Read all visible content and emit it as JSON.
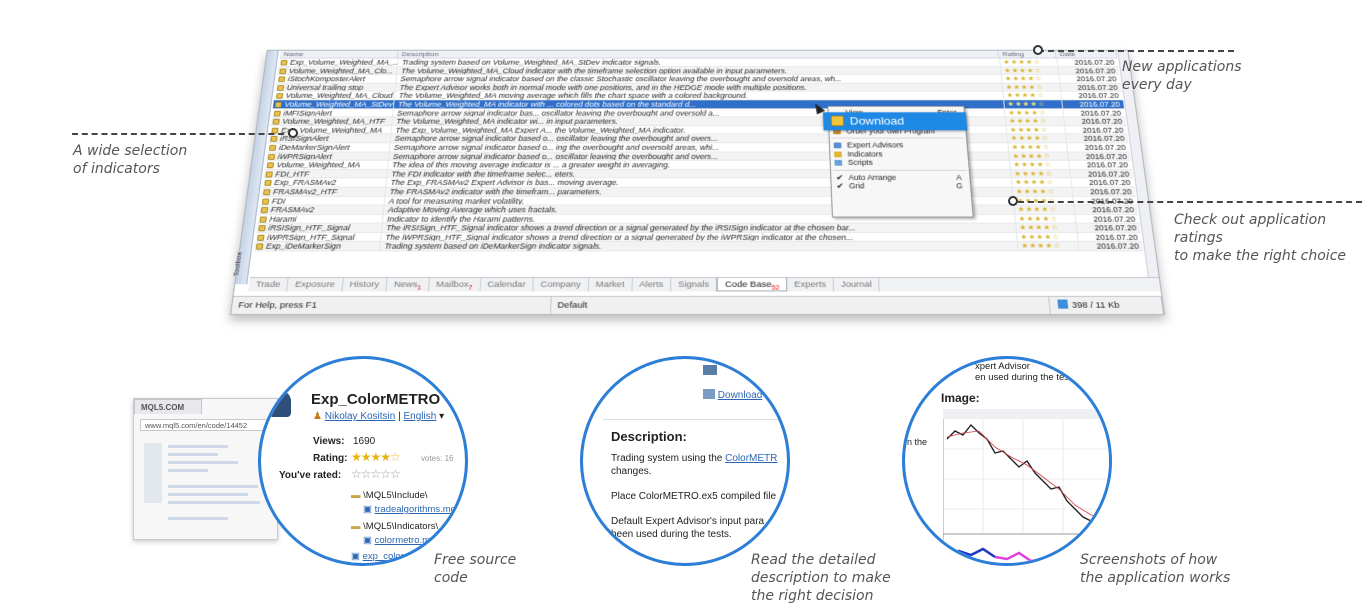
{
  "grid": {
    "columns": {
      "name": "Name",
      "description": "Description",
      "rating": "Rating",
      "date": "Date"
    },
    "rows": [
      {
        "name": "Exp_Volume_Weighted_MA_...",
        "description": "Trading system based on Volume_Weighted_MA_StDev indicator signals.",
        "rating": 4,
        "date": "2016.07.20"
      },
      {
        "name": "Volume_Weighted_MA_Clo...",
        "description": "The Volume_Weighted_MA_Cloud indicator with the timeframe selection option available in input parameters.",
        "rating": 4,
        "date": "2016.07.20"
      },
      {
        "name": "iStochKomposterAlert",
        "description": "Semaphore arrow signal indicator based on the classic Stochastic oscillator leaving the overbought and oversold areas, wh...",
        "rating": 4,
        "date": "2016.07.20"
      },
      {
        "name": "Universal trailing stop",
        "description": "The Expert Advisor works both in normal mode with one positions, and in the HEDGE mode with multiple positions.",
        "rating": 4,
        "date": "2016.07.20"
      },
      {
        "name": "Volume_Weighted_MA_Cloud",
        "description": "The Volume_Weighted_MA moving average which fills the chart space with a colored background.",
        "rating": 4,
        "date": "2016.07.20"
      },
      {
        "name": "Volume_Weighted_MA_StDev",
        "description": "The Volume_Weighted_MA indicator with ... colored dots based on the standard d...",
        "rating": 4,
        "date": "2016.07.20",
        "selected": true
      },
      {
        "name": "iMFISignAlert",
        "description": "Semaphore arrow signal indicator bas... oscillator leaving the overbought and oversold a...",
        "rating": 4,
        "date": "2016.07.20"
      },
      {
        "name": "Volume_Weighted_MA_HTF",
        "description": "The Volume_Weighted_MA indicator wi... in input parameters.",
        "rating": 4,
        "date": "2016.07.20"
      },
      {
        "name": "Exp_Volume_Weighted_MA",
        "description": "The Exp_Volume_Weighted_MA Expert A... the Volume_Weighted_MA indicator.",
        "rating": 4,
        "date": "2016.07.20"
      },
      {
        "name": "iRSISignAlert",
        "description": "Semaphore arrow signal indicator based o... oscillator leaving the overbought and overs...",
        "rating": 4,
        "date": "2016.07.20"
      },
      {
        "name": "iDeMarkerSignAlert",
        "description": "Semaphore arrow signal indicator based o... ing the overbought and oversold areas, whi...",
        "rating": 4,
        "date": "2016.07.20"
      },
      {
        "name": "iWPRSignAlert",
        "description": "Semaphore arrow signal indicator based o... oscillator leaving the overbought and overs...",
        "rating": 4,
        "date": "2016.07.20"
      },
      {
        "name": "Volume_Weighted_MA",
        "description": "The idea of this moving average indicator is ... a greater weight in averaging.",
        "rating": 4,
        "date": "2016.07.20"
      },
      {
        "name": "FDI_HTF",
        "description": "The FDI indicator with the timeframe selec... eters.",
        "rating": 4,
        "date": "2016.07.20"
      },
      {
        "name": "Exp_FRASMAv2",
        "description": "The Exp_FRASMAv2 Expert Advisor is bas... moving average.",
        "rating": 4,
        "date": "2016.07.20"
      },
      {
        "name": "FRASMAv2_HTF",
        "description": "The FRASMAv2 indicator with the timefram... parameters.",
        "rating": 4,
        "date": "2016.07.20"
      },
      {
        "name": "FDI",
        "description": "A tool for measuring market volatility.",
        "rating": 4,
        "date": "2016.07.20"
      },
      {
        "name": "FRASMAv2",
        "description": "Adaptive Moving Average which uses fractals.",
        "rating": 4,
        "date": "2016.07.20"
      },
      {
        "name": "Harami",
        "description": "Indicator to identify the Harami patterns.",
        "rating": 4,
        "date": "2016.07.20"
      },
      {
        "name": "iRSISign_HTF_Signal",
        "description": "The iRSISign_HTF_Signal indicator shows a trend direction or a signal generated by the iRSISign indicator at the chosen bar...",
        "rating": 4,
        "date": "2016.07.20"
      },
      {
        "name": "iWPRSign_HTF_Signal",
        "description": "The iWPRSign_HTF_Signal indicator shows a trend direction or a signal generated by the iWPRSign indicator at the chosen...",
        "rating": 4,
        "date": "2016.07.20"
      },
      {
        "name": "Exp_iDeMarkerSign",
        "description": "Trading system based on iDeMarkerSign indicator signals.",
        "rating": 4,
        "date": "2016.07.20"
      }
    ]
  },
  "toolbox_label": "Toolbox",
  "tabs": [
    {
      "label": "Trade"
    },
    {
      "label": "Exposure"
    },
    {
      "label": "History"
    },
    {
      "label": "News",
      "badge": "1"
    },
    {
      "label": "Mailbox",
      "badge": "7"
    },
    {
      "label": "Calendar"
    },
    {
      "label": "Company"
    },
    {
      "label": "Market"
    },
    {
      "label": "Alerts"
    },
    {
      "label": "Signals"
    },
    {
      "label": "Code Base",
      "badge": "52",
      "active": true
    },
    {
      "label": "Experts"
    },
    {
      "label": "Journal"
    }
  ],
  "status": {
    "help": "For Help, press F1",
    "profile": "Default",
    "traffic": "398 / 11 Kb"
  },
  "context_menu": {
    "view": "View",
    "view_key": "Enter",
    "download": "Download",
    "order": "Order your own Program",
    "experts": "Expert Advisors",
    "indicators": "Indicators",
    "scripts": "Scripts",
    "auto_arrange": "Auto Arrange",
    "auto_arrange_key": "A",
    "grid": "Grid",
    "grid_key": "G"
  },
  "callouts": {
    "new_apps": [
      "New applications",
      "every day"
    ],
    "indicators": [
      "A wide selection",
      "of indicators"
    ],
    "ratings": [
      "Check out application ratings",
      "to make the right choice"
    ],
    "source": [
      "Free source",
      "code"
    ],
    "description": [
      "Read the detailed",
      "description to make",
      "the right decision"
    ],
    "screenshots": [
      "Screenshots of how",
      "the application works"
    ]
  },
  "mql5": {
    "tab": "MQL5.COM",
    "url": "www.mql5.com/en/code/14452"
  },
  "source_panel": {
    "title": "Exp_ColorMETRO -",
    "author": "Nikolay Kositsin",
    "lang": "English",
    "views_label": "Views:",
    "views": "1690",
    "rating_label": "Rating:",
    "votes": "votes: 16",
    "rated_label": "You've rated:",
    "folder1": "\\MQL5\\Include\\",
    "file1": "tradealgorithms.mq",
    "folder2": "\\MQL5\\Indicators\\",
    "file2": "colormetro.mq",
    "file3": "exp_colorme"
  },
  "desc_panel": {
    "download": "Download",
    "heading": "Description:",
    "p1a": "Trading system using the",
    "p1link": "ColorMETR",
    "p1b": "changes.",
    "p2": "Place ColorMETRO.ex5 compiled file",
    "p3a": "Default Expert Advisor's input para",
    "p3b": "been used during the tests."
  },
  "image_panel": {
    "top_a": "xpert Advisor",
    "top_b": "en used during the tests.",
    "heading": "Image:",
    "side": "n the"
  },
  "colors": {
    "accent": "#2c7ed7",
    "selection": "#2f6fc9",
    "star": "#d9b22a"
  }
}
